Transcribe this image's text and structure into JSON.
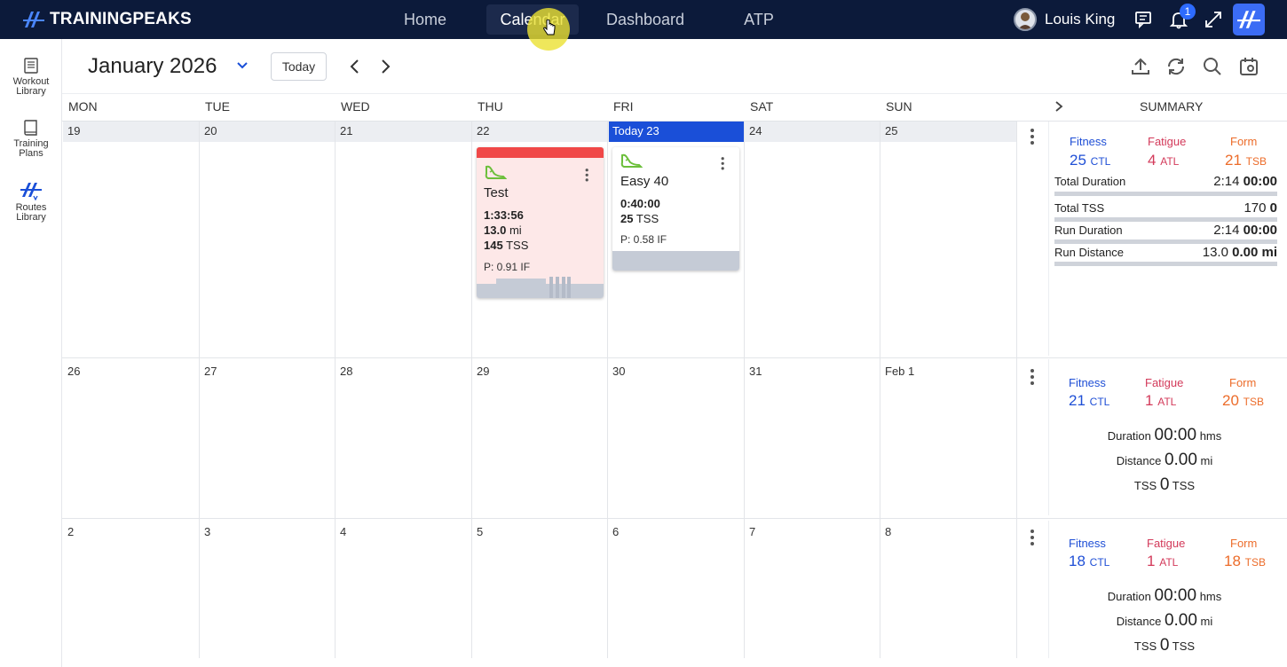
{
  "brand": {
    "name": "TRAININGPEAKS"
  },
  "nav": [
    "Home",
    "Calendar",
    "Dashboard",
    "ATP"
  ],
  "user": {
    "name": "Louis King",
    "notifications": "1"
  },
  "rail": [
    {
      "label": "Workout Library",
      "icon": "library-icon"
    },
    {
      "label": "Training Plans",
      "icon": "book-icon"
    },
    {
      "label": "Routes Library",
      "icon": "routes-icon"
    }
  ],
  "header": {
    "month": "January 2026",
    "today_label": "Today"
  },
  "days": [
    "MON",
    "TUE",
    "WED",
    "THU",
    "FRI",
    "SAT",
    "SUN"
  ],
  "summary_label": "SUMMARY",
  "weeks": [
    {
      "dates": [
        "19",
        "20",
        "21",
        "22",
        "Today 23",
        "24",
        "25"
      ]
    },
    {
      "dates": [
        "26",
        "27",
        "28",
        "29",
        "30",
        "31",
        "Feb 1"
      ]
    },
    {
      "dates": [
        "2",
        "3",
        "4",
        "5",
        "6",
        "7",
        "8"
      ]
    }
  ],
  "workouts": [
    {
      "title": "Test",
      "duration": "1:33:56",
      "distance_val": "13.0",
      "distance_unit": "mi",
      "tss_val": "145",
      "tss_unit": "TSS",
      "if": "P: 0.91 IF",
      "status_color": "#f04848",
      "bg": "#fde8e8"
    },
    {
      "title": "Easy 40",
      "duration": "0:40:00",
      "tss_val": "25",
      "tss_unit": "TSS",
      "if": "P: 0.58 IF",
      "bg": "#ffffff"
    }
  ],
  "summaries": [
    {
      "fitness_label": "Fitness",
      "fitness_val": "25",
      "fitness_unit": "CTL",
      "fatigue_label": "Fatigue",
      "fatigue_val": "4",
      "fatigue_unit": "ATL",
      "form_label": "Form",
      "form_val": "21",
      "form_unit": "TSB",
      "rows": [
        {
          "label": "Total Duration",
          "actual": "2:14",
          "planned": "00:00"
        },
        {
          "label": "Total TSS",
          "actual": "170",
          "planned": "0"
        },
        {
          "label": "Run Duration",
          "actual": "2:14",
          "planned": "00:00"
        },
        {
          "label": "Run Distance",
          "actual": "13.0",
          "planned": "0.00 mi"
        }
      ]
    },
    {
      "fitness_label": "Fitness",
      "fitness_val": "21",
      "fitness_unit": "CTL",
      "fatigue_label": "Fatigue",
      "fatigue_val": "1",
      "fatigue_unit": "ATL",
      "form_label": "Form",
      "form_val": "20",
      "form_unit": "TSB",
      "duration_label": "Duration",
      "duration_val": "00:00",
      "duration_unit": "hms",
      "distance_label": "Distance",
      "distance_val": "0.00",
      "distance_unit": "mi",
      "tss_label": "TSS",
      "tss_val": "0",
      "tss_unit": "TSS"
    },
    {
      "fitness_label": "Fitness",
      "fitness_val": "18",
      "fitness_unit": "CTL",
      "fatigue_label": "Fatigue",
      "fatigue_val": "1",
      "fatigue_unit": "ATL",
      "form_label": "Form",
      "form_val": "18",
      "form_unit": "TSB",
      "duration_label": "Duration",
      "duration_val": "00:00",
      "duration_unit": "hms",
      "distance_label": "Distance",
      "distance_val": "0.00",
      "distance_unit": "mi",
      "tss_label": "TSS",
      "tss_val": "0",
      "tss_unit": "TSS"
    }
  ],
  "colors": {
    "nav_bg": "#0c1a3a",
    "today": "#1a4fd8",
    "fitness": "#1f4fd6",
    "fatigue": "#d33a5a",
    "form": "#ec6c2a",
    "run_icon": "#6cbf3b"
  }
}
